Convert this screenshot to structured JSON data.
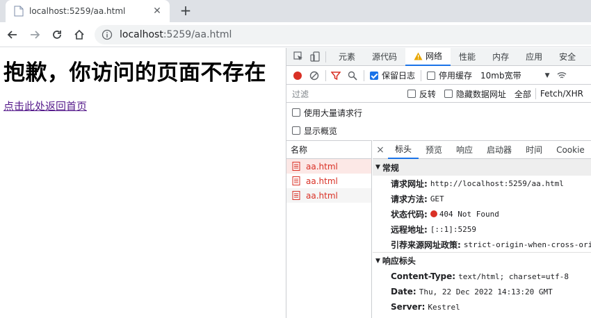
{
  "browser": {
    "tab_title": "localhost:5259/aa.html",
    "close_glyph": "✕",
    "newtab_glyph": "+",
    "url_host": "localhost",
    "url_rest": ":5259/aa.html"
  },
  "page": {
    "heading": "抱歉，你访问的页面不存在",
    "link": "点击此处返回首页",
    "link_color": "#551a8b"
  },
  "devtools": {
    "tabs": [
      "元素",
      "源代码",
      "网络",
      "性能",
      "内存",
      "应用",
      "安全"
    ],
    "active_tab": "网络",
    "toolbar": {
      "preserve_log": "保留日志",
      "disable_cache": "停用缓存",
      "throttle": "10mb宽带"
    },
    "filter": {
      "placeholder": "过滤",
      "invert": "反转",
      "hide_data_urls": "隐藏数据网址",
      "all": "全部",
      "fetch_xhr": "Fetch/XHR"
    },
    "options": {
      "big_rows": "使用大量请求行",
      "overview": "显示概览"
    },
    "requests": {
      "header": "名称",
      "items": [
        "aa.html",
        "aa.html",
        "aa.html"
      ]
    },
    "detail": {
      "close_glyph": "×",
      "tabs": [
        "标头",
        "预览",
        "响应",
        "启动器",
        "时间",
        "Cookie"
      ],
      "general": {
        "title": "常规",
        "rows": [
          {
            "k": "请求网址:",
            "v": "http://localhost:5259/aa.html"
          },
          {
            "k": "请求方法:",
            "v": "GET"
          },
          {
            "k": "状态代码:",
            "v": "404 Not Found"
          },
          {
            "k": "远程地址:",
            "v": "[::1]:5259"
          },
          {
            "k": "引荐来源网址政策:",
            "v": "strict-origin-when-cross-ori"
          }
        ]
      },
      "response": {
        "title": "响应标头",
        "rows": [
          {
            "k": "Content-Type:",
            "v": "text/html; charset=utf-8"
          },
          {
            "k": "Date:",
            "v": "Thu, 22 Dec 2022 14:13:20 GMT"
          },
          {
            "k": "Server:",
            "v": "Kestrel"
          }
        ]
      }
    },
    "colors": {
      "accent": "#1a73e8",
      "error": "#d93025"
    }
  }
}
